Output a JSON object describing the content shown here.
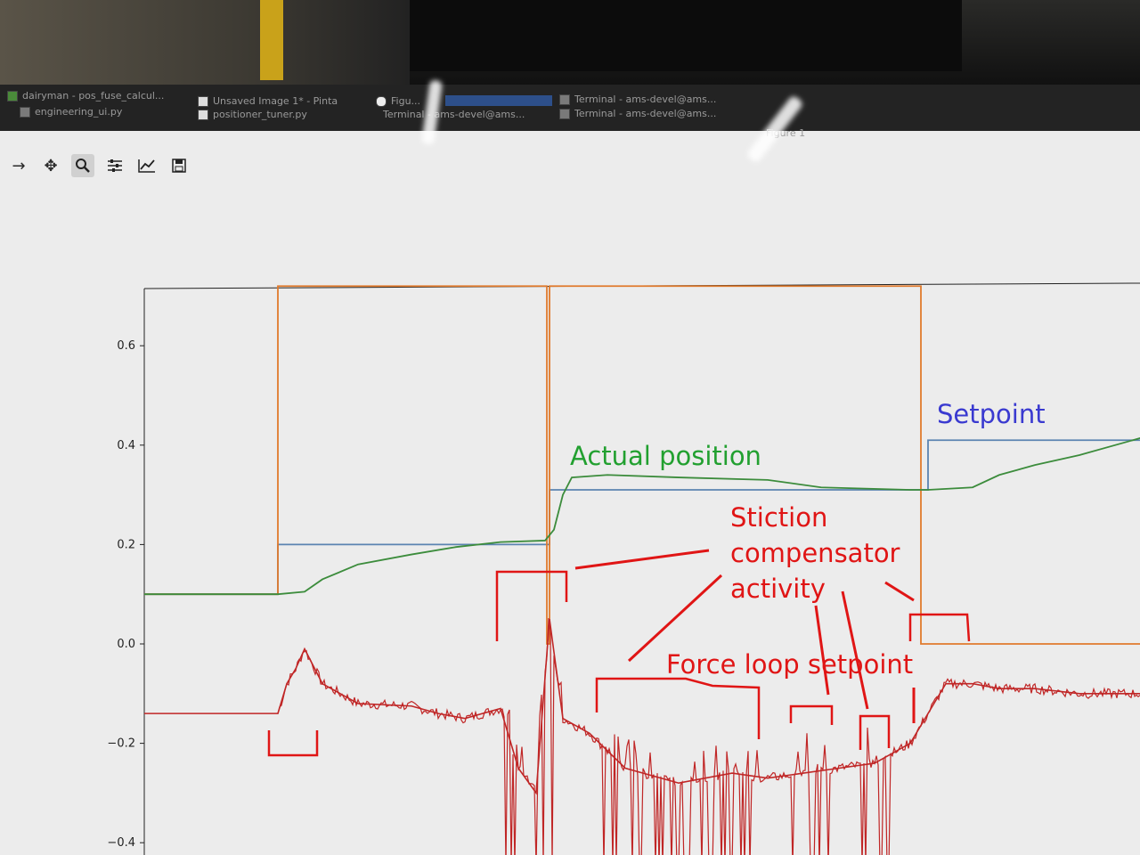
{
  "taskbar": {
    "items": [
      {
        "line1": "dairyman - pos_fuse_calcul...",
        "line2": "engineering_ui.py"
      },
      {
        "line1": "Unsaved Image 1* - Pinta",
        "line2": "positioner_tuner.py"
      },
      {
        "line1": "Figu...",
        "line2": "Terminal - ams-devel@ams..."
      },
      {
        "line1": "Terminal - ams-devel@ams...",
        "line2": "Terminal - ams-devel@ams..."
      }
    ],
    "window_title": "Figure 1"
  },
  "toolbar": {
    "buttons": [
      "forward-icon",
      "pan-icon",
      "zoom-icon",
      "subplots-icon",
      "axes-edit-icon",
      "save-icon"
    ],
    "active": "zoom-icon",
    "glyphs": {
      "forward": "→",
      "pan": "✥",
      "zoom": "🔍",
      "subplots": "☰",
      "edit": "📈",
      "save": "💾"
    }
  },
  "annotations": {
    "setpoint": {
      "text": "Setpoint",
      "color": "#3a3ad0"
    },
    "actual_position": {
      "text": "Actual position",
      "color": "#22a030"
    },
    "stiction_line1": {
      "text": "Stiction",
      "color": "#e01515"
    },
    "stiction_line2": {
      "text": "compensator",
      "color": "#e01515"
    },
    "stiction_line3": {
      "text": "activity",
      "color": "#e01515"
    },
    "force_loop": {
      "text": "Force loop setpoint",
      "color": "#e01515"
    }
  },
  "chart_data": {
    "type": "line",
    "ylim": [
      -0.4,
      0.72
    ],
    "x_ticks_visible": false,
    "grid": false,
    "yticks": [
      {
        "value": 0.6,
        "label": "0.6"
      },
      {
        "value": 0.4,
        "label": "0.4"
      },
      {
        "value": 0.2,
        "label": "0.2"
      },
      {
        "value": 0.0,
        "label": "0.0"
      },
      {
        "value": -0.2,
        "label": "−0.2"
      },
      {
        "value": -0.4,
        "label": "−0.4"
      }
    ],
    "series": [
      {
        "color": "#5b84b1",
        "x": [
          0,
          150,
          150,
          455,
          455,
          880,
          880,
          1120
        ],
        "values": [
          0.1,
          0.1,
          0.2,
          0.2,
          0.31,
          0.31,
          0.41,
          0.41
        ]
      },
      {
        "color": "#e07a2c",
        "x": [
          0,
          150,
          150,
          452,
          452,
          455,
          455,
          872,
          872,
          876,
          876,
          1120
        ],
        "values": [
          0.1,
          0.1,
          0.72,
          0.72,
          0.0,
          0.0,
          0.72,
          0.72,
          0.0,
          0.0,
          0.0,
          0.0
        ]
      },
      {
        "color": "#3c8c3c",
        "x": [
          0,
          150,
          180,
          200,
          240,
          300,
          350,
          400,
          450,
          460,
          470,
          480,
          520,
          600,
          700,
          760,
          860,
          880,
          930,
          960,
          1000,
          1050,
          1120
        ],
        "values": [
          0.1,
          0.1,
          0.105,
          0.13,
          0.16,
          0.18,
          0.195,
          0.205,
          0.208,
          0.23,
          0.3,
          0.335,
          0.34,
          0.335,
          0.33,
          0.315,
          0.31,
          0.31,
          0.315,
          0.34,
          0.36,
          0.38,
          0.415
        ]
      },
      {
        "color": "#c02626",
        "x": [
          0,
          150,
          160,
          170,
          180,
          200,
          240,
          300,
          330,
          360,
          400,
          420,
          440,
          455,
          470,
          500,
          540,
          600,
          660,
          700,
          740,
          780,
          820,
          860,
          900,
          930,
          960,
          1000,
          1050,
          1120
        ],
        "values": [
          -0.14,
          -0.14,
          -0.08,
          -0.05,
          -0.01,
          -0.08,
          -0.12,
          -0.125,
          -0.14,
          -0.15,
          -0.13,
          -0.25,
          -0.3,
          0.05,
          -0.15,
          -0.18,
          -0.25,
          -0.28,
          -0.26,
          -0.27,
          -0.26,
          -0.25,
          -0.24,
          -0.2,
          -0.08,
          -0.08,
          -0.09,
          -0.09,
          -0.1,
          -0.1
        ]
      }
    ]
  }
}
